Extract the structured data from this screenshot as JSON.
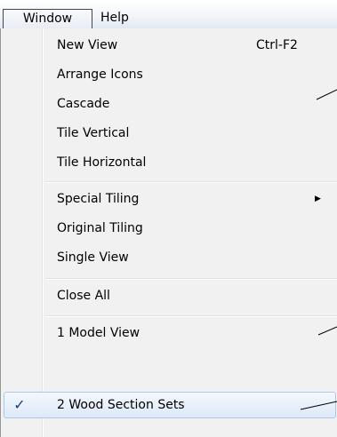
{
  "menubar": {
    "menus": [
      {
        "label": "Window",
        "open": true
      },
      {
        "label": "Help",
        "open": false
      }
    ]
  },
  "dropdown": {
    "items": [
      {
        "label": "New View",
        "shortcut": "Ctrl-F2"
      },
      {
        "label": "Arrange Icons"
      },
      {
        "label": "Cascade"
      },
      {
        "label": "Tile Vertical"
      },
      {
        "label": "Tile Horizontal"
      },
      {
        "label": "Special Tiling",
        "submenu": true,
        "submenu_icon": "triangle-right-icon"
      },
      {
        "label": "Original Tiling"
      },
      {
        "label": "Single View"
      },
      {
        "label": "Close All"
      },
      {
        "label": "1 Model View"
      },
      {
        "label": "2 Wood Section Sets",
        "checked": true,
        "check_glyph": "✓",
        "highlighted": true
      }
    ]
  },
  "colors": {
    "menubar_bg": "#f3f5f9",
    "dropdown_bg": "#f1f1f1",
    "highlight_border": "#a8c8ec",
    "check_color": "#1c3d86"
  }
}
